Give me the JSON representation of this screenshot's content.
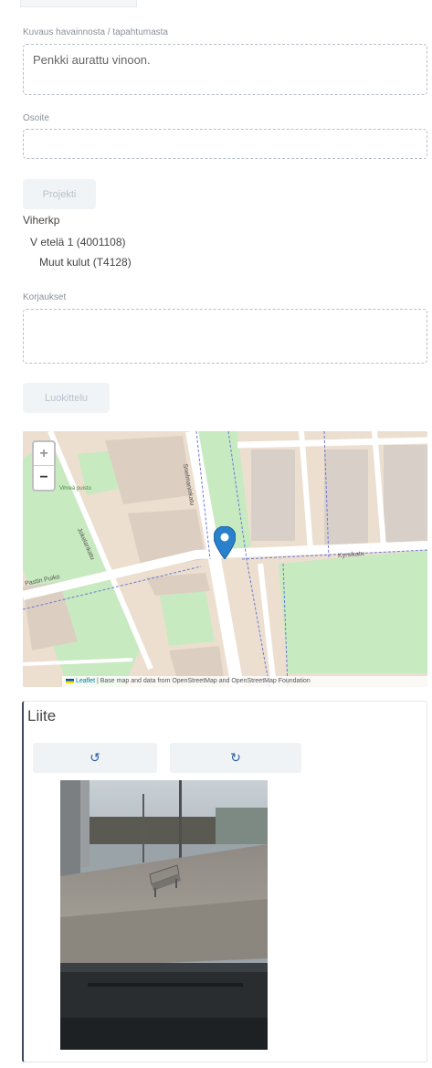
{
  "form": {
    "description": {
      "label": "Kuvaus havainnosta / tapahtumasta",
      "value": "Penkki aurattu vinoon."
    },
    "address": {
      "label": "Osoite",
      "value": ""
    },
    "project_button": "Projekti",
    "project_tree": {
      "level1": "Viherkp",
      "level2": "V etelä 1 (4001108)",
      "level3": "Muut kulut (T4128)"
    },
    "repairs": {
      "label": "Korjaukset",
      "value": ""
    },
    "classify_button": "Luokittelu"
  },
  "map": {
    "zoom_in": "+",
    "zoom_out": "−",
    "attribution_leaflet": "Leaflet",
    "attribution_text": "| Base map and data from OpenStreetMap and OpenStreetMap Foundation",
    "street_labels": {
      "vertical_street": "Snelmaninkatu",
      "east_street": "Kyrsikatu",
      "west_street": "Pastin Puiko",
      "diagonal_street": "Jokelankatu",
      "green_area": "Vihreä puisto"
    }
  },
  "attachment": {
    "title": "Liite",
    "rotate_left": "↺",
    "rotate_right": "↻"
  },
  "colors": {
    "marker": "#2a81cb",
    "park": "#c8eac0",
    "building": "#dccfc2",
    "road": "#ffffff"
  }
}
